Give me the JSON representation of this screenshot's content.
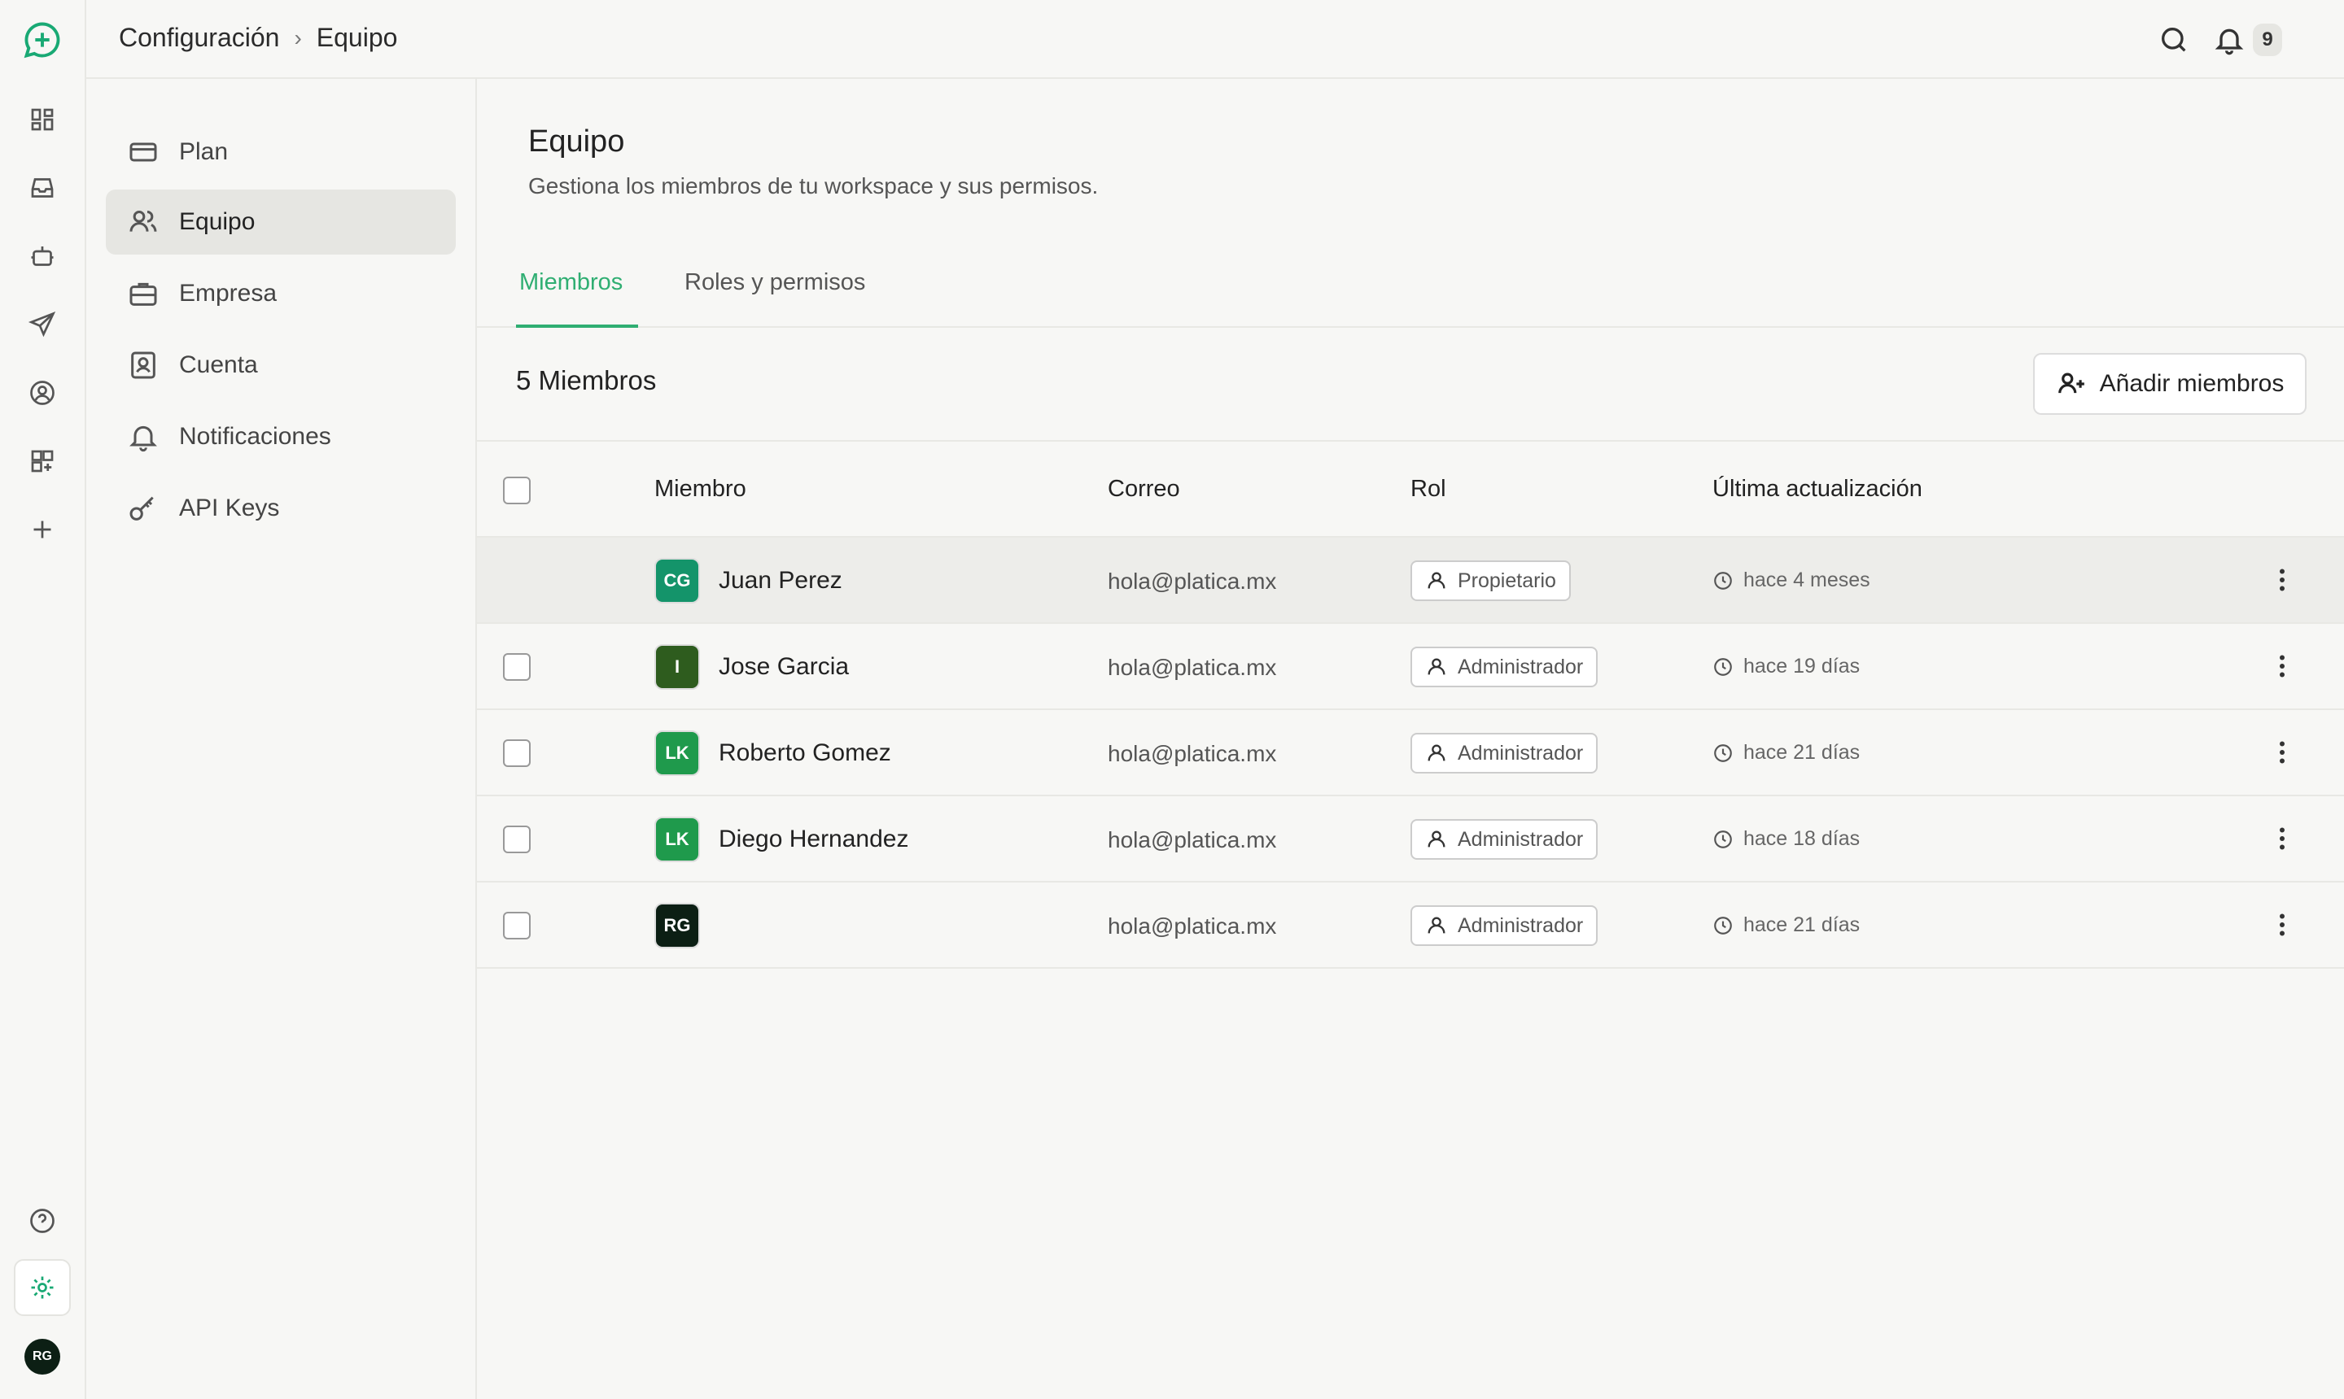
{
  "breadcrumb": {
    "parent": "Configuración",
    "separator": "›",
    "current": "Equipo"
  },
  "notifications": {
    "count": "9"
  },
  "rail": {
    "icons": [
      "chat-logo-icon",
      "dashboard-icon",
      "inbox-icon",
      "bot-icon",
      "send-icon",
      "contact-icon",
      "apps-icon",
      "plus-icon",
      "help-icon",
      "settings-icon"
    ],
    "avatar_initials": "RG"
  },
  "nav": {
    "items": [
      {
        "label": "Plan",
        "icon": "credit-card-icon"
      },
      {
        "label": "Equipo",
        "icon": "users-icon"
      },
      {
        "label": "Empresa",
        "icon": "briefcase-icon"
      },
      {
        "label": "Cuenta",
        "icon": "contact-card-icon"
      },
      {
        "label": "Notificaciones",
        "icon": "bell-icon"
      },
      {
        "label": "API Keys",
        "icon": "key-icon"
      }
    ]
  },
  "main": {
    "title": "Equipo",
    "subtitle": "Gestiona los miembros de tu workspace y sus permisos.",
    "tabs": [
      {
        "label": "Miembros"
      },
      {
        "label": "Roles y permisos"
      }
    ],
    "member_count": "5 Miembros",
    "add_button": "Añadir miembros"
  },
  "table": {
    "headers": {
      "member": "Miembro",
      "email": "Correo",
      "role": "Rol",
      "updated": "Última actualización"
    },
    "rows": [
      {
        "initials": "CG",
        "avatar_color": "#14946a",
        "name": "Juan Perez",
        "email": "hola@platica.mx",
        "role": "Propietario",
        "updated": "hace 4 meses"
      },
      {
        "initials": "I",
        "avatar_color": "#2e5c1e",
        "name": "Jose Garcia",
        "email": "hola@platica.mx",
        "role": "Administrador",
        "updated": "hace 19 días"
      },
      {
        "initials": "LK",
        "avatar_color": "#1f9a4c",
        "name": "Roberto Gomez",
        "email": "hola@platica.mx",
        "role": "Administrador",
        "updated": "hace 21 días"
      },
      {
        "initials": "LK",
        "avatar_color": "#1f9a4c",
        "name": "Diego Hernandez",
        "email": "hola@platica.mx",
        "role": "Administrador",
        "updated": "hace 18 días"
      },
      {
        "initials": "RG",
        "avatar_color": "#0c1f14",
        "name": "",
        "email": "hola@platica.mx",
        "role": "Administrador",
        "updated": "hace 21 días"
      }
    ]
  },
  "colors": {
    "accent": "#2fae72",
    "background": "#f7f7f5",
    "border": "#e8e8e4"
  }
}
